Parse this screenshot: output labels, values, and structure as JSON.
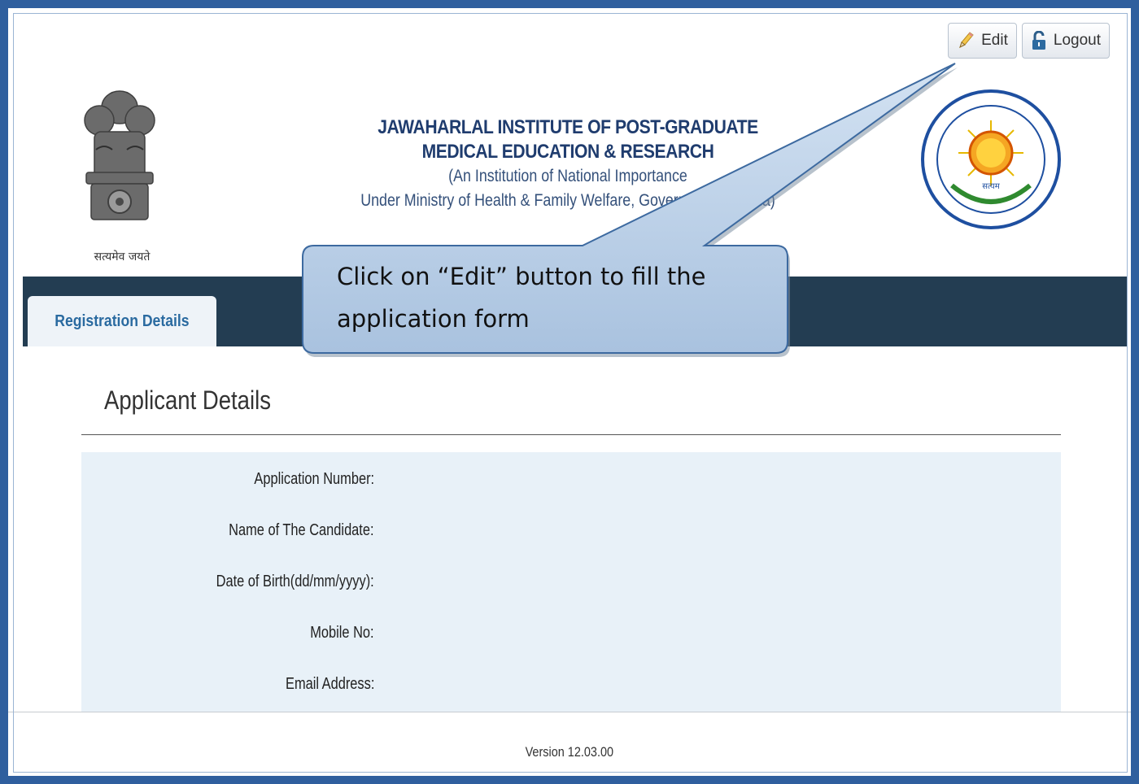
{
  "toolbar": {
    "edit_label": "Edit",
    "logout_label": "Logout",
    "edit_icon": "pencil-icon",
    "logout_icon": "unlock-icon"
  },
  "header": {
    "emblem_caption": "सत्यमेव जयते",
    "institute_line1": "JAWAHARLAL INSTITUTE OF POST-GRADUATE",
    "institute_line2": "MEDICAL EDUCATION & RESEARCH",
    "institute_line3": "(An Institution of National Importance",
    "institute_line4": "Under Ministry of Health & Family Welfare, Government of India)"
  },
  "tabs": [
    {
      "label": "Registration Details",
      "active": true
    }
  ],
  "section": {
    "title": "Applicant Details",
    "fields": [
      {
        "label": "Application Number:",
        "value": ""
      },
      {
        "label": "Name of The Candidate:",
        "value": ""
      },
      {
        "label": "Date of Birth(dd/mm/yyyy):",
        "value": ""
      },
      {
        "label": "Mobile No:",
        "value": ""
      },
      {
        "label": "Email Address:",
        "value": ""
      }
    ]
  },
  "footer": {
    "version": "Version 12.03.00"
  },
  "callout": {
    "text": "Click on “Edit” button to fill the application form"
  },
  "colors": {
    "outer_border": "#2f5f9e",
    "navbar": "#233d52",
    "tab_text": "#2a6aa0",
    "panel_bg": "#e8f1f8",
    "callout_fill": "#b8cee6"
  }
}
